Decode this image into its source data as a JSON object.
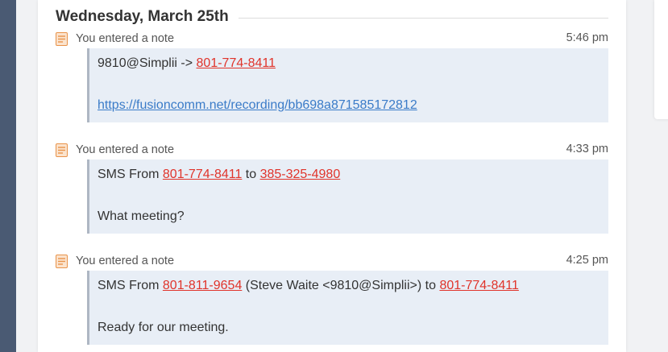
{
  "day": {
    "title": "Wednesday, March 25th"
  },
  "entries": [
    {
      "label": "You entered a note",
      "time": "5:46 pm",
      "line1": {
        "prefix": "9810@Simplii -> ",
        "phone": "801-774-8411"
      },
      "line2": {
        "link": "https://fusioncomm.net/recording/bb698a871585172812"
      }
    },
    {
      "label": "You entered a note",
      "time": "4:33 pm",
      "line1": {
        "prefix": "SMS From ",
        "phone_from": "801-774-8411",
        "mid": " to ",
        "phone_to": "385-325-4980"
      },
      "line2": {
        "text": "What meeting?"
      }
    },
    {
      "label": "You entered a note",
      "time": "4:25 pm",
      "line1": {
        "prefix": "SMS From ",
        "phone_from": "801-811-9654",
        "mid": " (Steve Waite <9810@Simplii>) to ",
        "phone_to": "801-774-8411"
      },
      "line2": {
        "text": "Ready for our meeting."
      }
    }
  ],
  "icons": {
    "note": "note-icon"
  },
  "colors": {
    "phone_link": "#e0342b",
    "url_link": "#3a7bc8",
    "note_bg": "#e8eef6",
    "note_icon": "#e8934a"
  }
}
